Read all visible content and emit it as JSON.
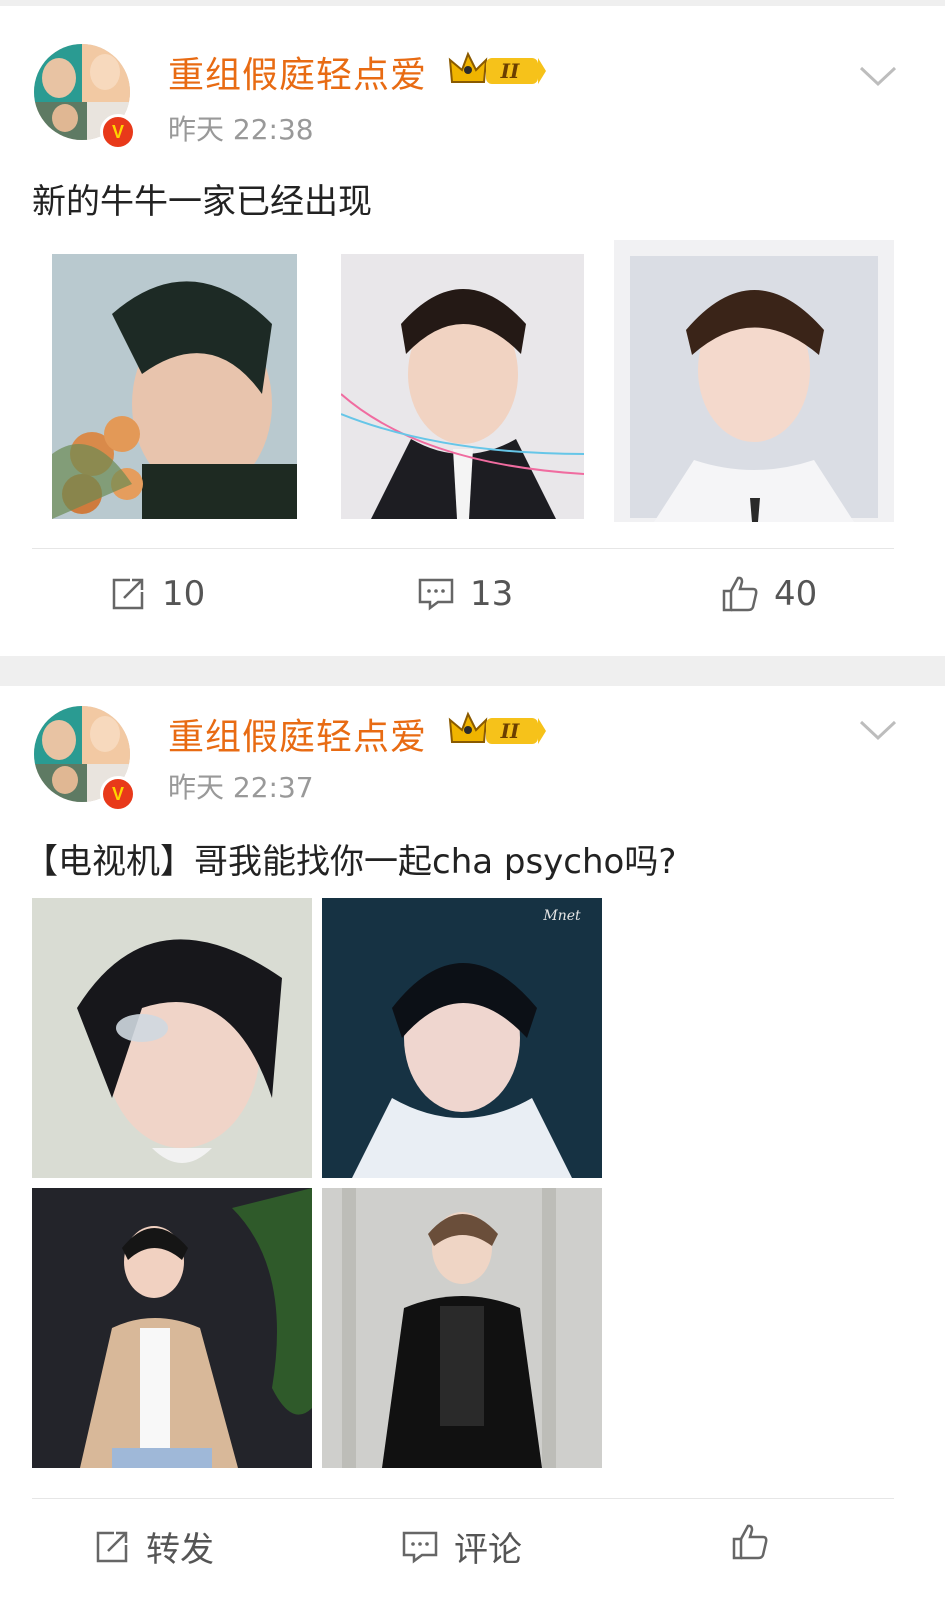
{
  "posts": [
    {
      "username": "重组假庭轻点爱",
      "level_badge": "II",
      "verified_mark": "V",
      "timestamp": "昨天 22:38",
      "text": "新的牛牛一家已经出现",
      "actions": {
        "repost": "10",
        "comment": "13",
        "like": "40"
      }
    },
    {
      "username": "重组假庭轻点爱",
      "level_badge": "II",
      "verified_mark": "V",
      "timestamp": "昨天 22:37",
      "text": "【电视机】哥我能找你一起cha psycho吗?",
      "photo_caption": "Mnet",
      "actions": {
        "repost": "转发",
        "comment": "评论"
      }
    }
  ],
  "icons": [
    "repost-icon",
    "comment-icon",
    "like-icon",
    "chevron-down-icon",
    "crown-icon"
  ],
  "colors": {
    "username": "#e86b13",
    "meta": "#999999",
    "background": "#efefef",
    "card": "#ffffff"
  }
}
